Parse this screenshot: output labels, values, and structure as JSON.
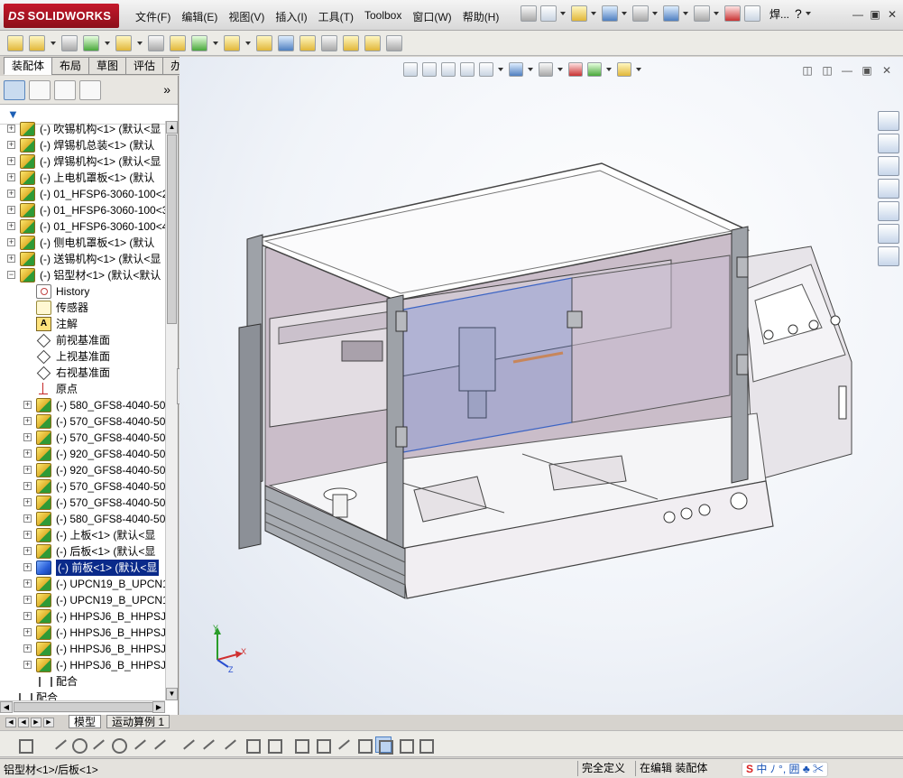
{
  "app": {
    "logo_ds": "DS",
    "logo_text": "SOLIDWORKS",
    "doc_title": "焊...",
    "help_icon": "?"
  },
  "menu": [
    "文件(F)",
    "编辑(E)",
    "视图(V)",
    "插入(I)",
    "工具(T)",
    "Toolbox",
    "窗口(W)",
    "帮助(H)"
  ],
  "command_tabs": [
    "装配体",
    "布局",
    "草图",
    "评估",
    "办公室产品"
  ],
  "active_command_tab": "装配体",
  "feature_tree": {
    "collapse_label": "»",
    "nodes": [
      {
        "label": "(-) 吹锡机构<1> (默认<显",
        "type": "component",
        "level": 0,
        "expanded": false
      },
      {
        "label": "(-) 焊锡机总装<1> (默认",
        "type": "component",
        "level": 0,
        "expanded": false
      },
      {
        "label": "(-) 焊锡机构<1> (默认<显",
        "type": "component",
        "level": 0,
        "expanded": false
      },
      {
        "label": "(-) 上电机罩板<1> (默认",
        "type": "component",
        "level": 0,
        "expanded": false
      },
      {
        "label": "(-) 01_HFSP6-3060-100<2",
        "type": "component",
        "level": 0,
        "expanded": false
      },
      {
        "label": "(-) 01_HFSP6-3060-100<3",
        "type": "component",
        "level": 0,
        "expanded": false
      },
      {
        "label": "(-) 01_HFSP6-3060-100<4",
        "type": "component",
        "level": 0,
        "expanded": false
      },
      {
        "label": "(-) 侧电机罩板<1> (默认",
        "type": "component",
        "level": 0,
        "expanded": false
      },
      {
        "label": "(-) 送锡机构<1> (默认<显",
        "type": "component",
        "level": 0,
        "expanded": false
      },
      {
        "label": "(-) 铝型材<1> (默认<默认",
        "type": "component",
        "level": 0,
        "expanded": true
      },
      {
        "label": "History",
        "type": "history",
        "level": 1
      },
      {
        "label": "传感器",
        "type": "sensor",
        "level": 1
      },
      {
        "label": "注解",
        "type": "note",
        "level": 1
      },
      {
        "label": "前视基准面",
        "type": "plane",
        "level": 1
      },
      {
        "label": "上视基准面",
        "type": "plane",
        "level": 1
      },
      {
        "label": "右视基准面",
        "type": "plane",
        "level": 1
      },
      {
        "label": "原点",
        "type": "origin",
        "level": 1
      },
      {
        "label": "(-) 580_GFS8-4040-50",
        "type": "component",
        "level": 1,
        "expanded": false
      },
      {
        "label": "(-) 570_GFS8-4040-50",
        "type": "component",
        "level": 1,
        "expanded": false
      },
      {
        "label": "(-) 570_GFS8-4040-50",
        "type": "component",
        "level": 1,
        "expanded": false
      },
      {
        "label": "(-) 920_GFS8-4040-50",
        "type": "component",
        "level": 1,
        "expanded": false
      },
      {
        "label": "(-) 920_GFS8-4040-50",
        "type": "component",
        "level": 1,
        "expanded": false
      },
      {
        "label": "(-) 570_GFS8-4040-50",
        "type": "component",
        "level": 1,
        "expanded": false
      },
      {
        "label": "(-) 570_GFS8-4040-50",
        "type": "component",
        "level": 1,
        "expanded": false
      },
      {
        "label": "(-) 580_GFS8-4040-50",
        "type": "component",
        "level": 1,
        "expanded": false
      },
      {
        "label": "(-) 上板<1> (默认<显",
        "type": "component",
        "level": 1,
        "expanded": false
      },
      {
        "label": "(-) 后板<1> (默认<显",
        "type": "component",
        "level": 1,
        "expanded": false
      },
      {
        "label": "(-) 前板<1> (默认<显",
        "type": "component",
        "level": 1,
        "expanded": false,
        "selected": true
      },
      {
        "label": "(-) UPCN19_B_UPCN19-",
        "type": "component",
        "level": 1,
        "expanded": false
      },
      {
        "label": "(-) UPCN19_B_UPCN19-",
        "type": "component",
        "level": 1,
        "expanded": false
      },
      {
        "label": "(-) HHPSJ6_B_HHPSJ6-",
        "type": "component",
        "level": 1,
        "expanded": false
      },
      {
        "label": "(-) HHPSJ6_B_HHPSJ6-",
        "type": "component",
        "level": 1,
        "expanded": false
      },
      {
        "label": "(-) HHPSJ6_B_HHPSJ6-",
        "type": "component",
        "level": 1,
        "expanded": false
      },
      {
        "label": "(-) HHPSJ6_B_HHPSJ6-",
        "type": "component",
        "level": 1,
        "expanded": false
      },
      {
        "label": "配合",
        "type": "mate",
        "level": 1
      },
      {
        "label": "配合",
        "type": "mate",
        "level": 0
      }
    ]
  },
  "model_tabs": [
    "模型",
    "运动算例 1"
  ],
  "active_model_tab": "模型",
  "statusbar": {
    "path": "铝型材<1>/后板<1>",
    "state": "完全定义",
    "mode": "在编辑 装配体",
    "ime_text": "中 ﾉ °, 囲 ♣ ✂"
  },
  "triad": {
    "x": "X",
    "y": "Y",
    "z": "Z"
  },
  "colors": {
    "enclosure": "#d8ccd6",
    "frame": "#9ea2a8",
    "glass": "#5c7fd8",
    "accent_orange": "#f08a2c",
    "selection": "#0a2a8a",
    "brand_red": "#c4182a"
  },
  "side_badge": "5"
}
